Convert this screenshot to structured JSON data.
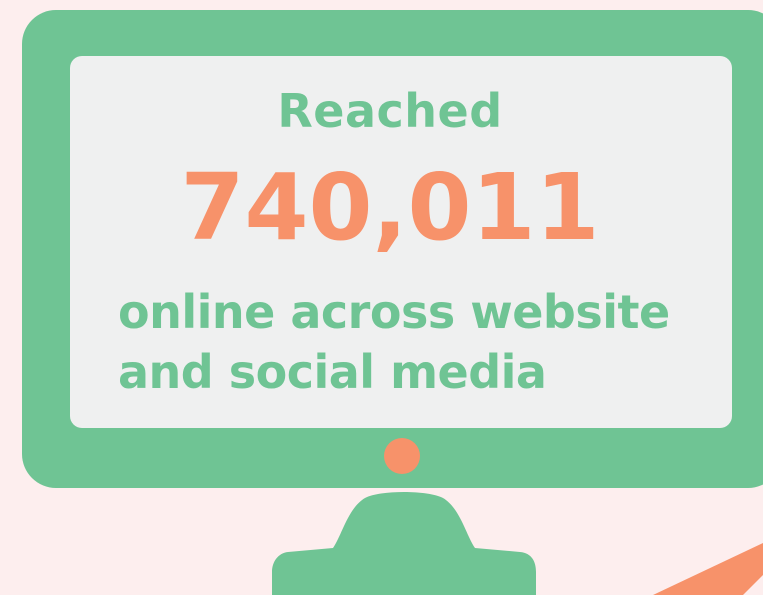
{
  "content": {
    "headline": "Reached",
    "metric_value": "740,011",
    "description_line1": "online across website",
    "description_line2": "and social media"
  },
  "colors": {
    "background": "#fdeeee",
    "monitor_green": "#6fc494",
    "screen": "#eff0f0",
    "accent_orange": "#f7926a"
  }
}
